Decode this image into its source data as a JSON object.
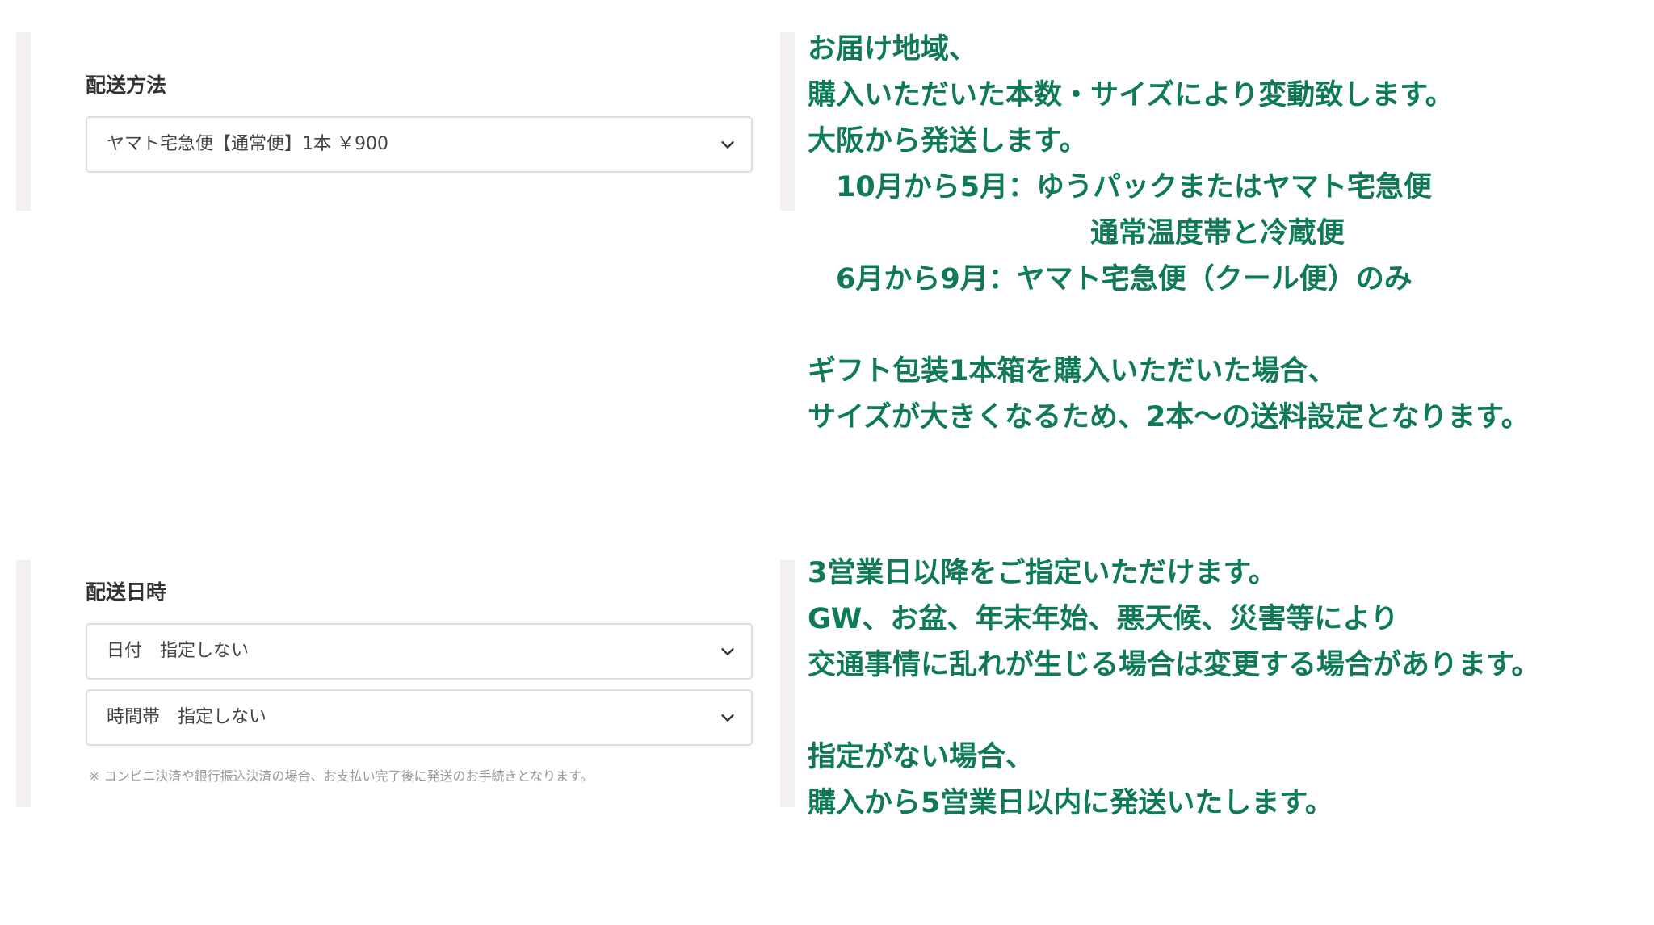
{
  "shipping_method": {
    "heading": "配送方法",
    "select_value": "ヤマト宅急便【通常便】1本 ￥900"
  },
  "shipping_datetime": {
    "heading": "配送日時",
    "date_select_value": "日付　指定しない",
    "time_select_value": "時間帯　指定しない",
    "note": "※ コンビニ決済や銀行振込決済の場合、お支払い完了後に発送のお手続きとなります。"
  },
  "info_top": {
    "lines": [
      "お届け地域、",
      "購入いただいた本数・サイズにより変動致します。",
      "大阪から発送します。",
      "　10月から5月：ゆうパックまたはヤマト宅急便",
      "　　　　　　　　　　通常温度帯と冷蔵便",
      "　6月から9月：ヤマト宅急便（クール便）のみ",
      "",
      "ギフト包装1本箱を購入いただいた場合、",
      "サイズが大きくなるため、2本～の送料設定となります。"
    ]
  },
  "info_bottom": {
    "lines": [
      "3営業日以降をご指定いただけます。",
      "GW、お盆、年末年始、悪天候、災害等により",
      "交通事情に乱れが生じる場合は変更する場合があります。",
      "",
      "指定がない場合、",
      "購入から5営業日以内に発送いたします。"
    ]
  },
  "colors": {
    "info_text": "#0f7a57",
    "panel_bar": "#f4eff0",
    "select_border": "#dcdcdc"
  },
  "icons": {
    "select_arrow": "chevron-down-icon"
  }
}
